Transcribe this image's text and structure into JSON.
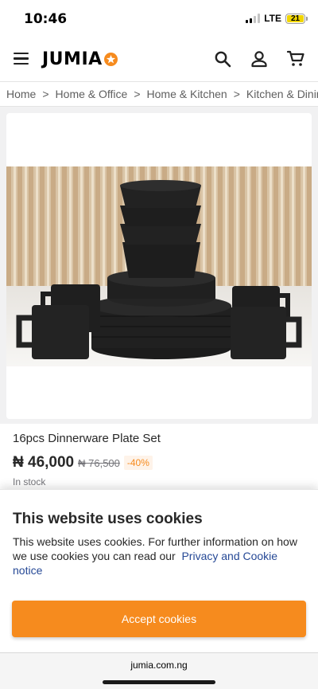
{
  "status_bar": {
    "time": "10:46",
    "network": "LTE",
    "battery": "21"
  },
  "header": {
    "logo_text": "JUMIA",
    "icons": [
      "menu-icon",
      "search-icon",
      "account-icon",
      "cart-icon"
    ],
    "colors": {
      "brand_orange": "#f68b1e"
    }
  },
  "breadcrumb": {
    "items": [
      "Home",
      "Home & Office",
      "Home & Kitchen",
      "Kitchen & Dining"
    ],
    "separator": ">"
  },
  "product": {
    "title": "16pcs Dinnerware Plate Set",
    "price": "₦ 46,000",
    "old_price": "₦ 76,500",
    "discount": "-40%",
    "stock": "In stock"
  },
  "cookie_banner": {
    "title": "This website uses cookies",
    "text": "This website uses cookies. For further information on how we use cookies you can read our",
    "link": "Privacy and Cookie notice",
    "button": "Accept cookies"
  },
  "browser": {
    "url": "jumia.com.ng"
  }
}
